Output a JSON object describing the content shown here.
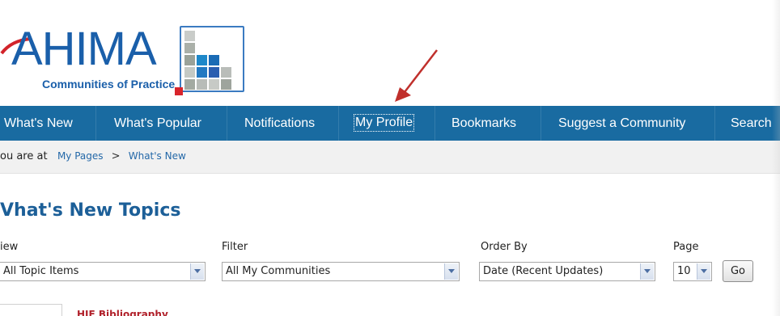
{
  "logo": {
    "brand": "AHIMA",
    "subtitle": "Communities of Practice"
  },
  "nav": {
    "items": [
      {
        "label": "What's New"
      },
      {
        "label": "What's Popular"
      },
      {
        "label": "Notifications"
      },
      {
        "label": "My Profile"
      },
      {
        "label": "Bookmarks"
      },
      {
        "label": "Suggest a Community"
      },
      {
        "label": "Search"
      }
    ]
  },
  "breadcrumb": {
    "prefix": "ou are at",
    "items": [
      "My Pages",
      "What's New"
    ],
    "separator": ">"
  },
  "page_title": "Vhat's New Topics",
  "filters": {
    "view_label": "iew",
    "view_value": "All Topic Items",
    "filter_label": "Filter",
    "filter_value": "All My Communities",
    "order_label": "Order By",
    "order_value": "Date (Recent Updates)",
    "page_label": "Page",
    "page_value": "10",
    "go_label": "Go"
  },
  "partial_item": {
    "link_text": "HIE Bibliography"
  },
  "colors": {
    "nav_bg": "#196ba1",
    "brand_blue": "#1a5faa",
    "title_blue": "#1c5f98",
    "link_blue": "#2468a8",
    "annotation_red": "#c0302c"
  }
}
